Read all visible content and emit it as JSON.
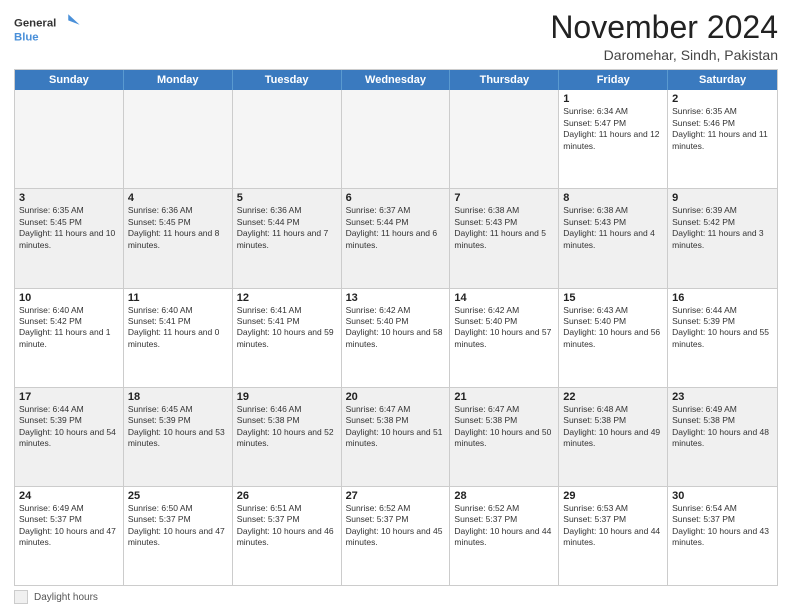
{
  "logo": {
    "line1": "General",
    "line2": "Blue"
  },
  "title": "November 2024",
  "location": "Daromehar, Sindh, Pakistan",
  "weekdays": [
    "Sunday",
    "Monday",
    "Tuesday",
    "Wednesday",
    "Thursday",
    "Friday",
    "Saturday"
  ],
  "legend": {
    "box_label": "Daylight hours"
  },
  "weeks": [
    [
      {
        "day": "",
        "info": "",
        "empty": true
      },
      {
        "day": "",
        "info": "",
        "empty": true
      },
      {
        "day": "",
        "info": "",
        "empty": true
      },
      {
        "day": "",
        "info": "",
        "empty": true
      },
      {
        "day": "",
        "info": "",
        "empty": true
      },
      {
        "day": "1",
        "info": "Sunrise: 6:34 AM\nSunset: 5:47 PM\nDaylight: 11 hours and 12 minutes.",
        "empty": false
      },
      {
        "day": "2",
        "info": "Sunrise: 6:35 AM\nSunset: 5:46 PM\nDaylight: 11 hours and 11 minutes.",
        "empty": false
      }
    ],
    [
      {
        "day": "3",
        "info": "Sunrise: 6:35 AM\nSunset: 5:45 PM\nDaylight: 11 hours and 10 minutes.",
        "empty": false
      },
      {
        "day": "4",
        "info": "Sunrise: 6:36 AM\nSunset: 5:45 PM\nDaylight: 11 hours and 8 minutes.",
        "empty": false
      },
      {
        "day": "5",
        "info": "Sunrise: 6:36 AM\nSunset: 5:44 PM\nDaylight: 11 hours and 7 minutes.",
        "empty": false
      },
      {
        "day": "6",
        "info": "Sunrise: 6:37 AM\nSunset: 5:44 PM\nDaylight: 11 hours and 6 minutes.",
        "empty": false
      },
      {
        "day": "7",
        "info": "Sunrise: 6:38 AM\nSunset: 5:43 PM\nDaylight: 11 hours and 5 minutes.",
        "empty": false
      },
      {
        "day": "8",
        "info": "Sunrise: 6:38 AM\nSunset: 5:43 PM\nDaylight: 11 hours and 4 minutes.",
        "empty": false
      },
      {
        "day": "9",
        "info": "Sunrise: 6:39 AM\nSunset: 5:42 PM\nDaylight: 11 hours and 3 minutes.",
        "empty": false
      }
    ],
    [
      {
        "day": "10",
        "info": "Sunrise: 6:40 AM\nSunset: 5:42 PM\nDaylight: 11 hours and 1 minute.",
        "empty": false
      },
      {
        "day": "11",
        "info": "Sunrise: 6:40 AM\nSunset: 5:41 PM\nDaylight: 11 hours and 0 minutes.",
        "empty": false
      },
      {
        "day": "12",
        "info": "Sunrise: 6:41 AM\nSunset: 5:41 PM\nDaylight: 10 hours and 59 minutes.",
        "empty": false
      },
      {
        "day": "13",
        "info": "Sunrise: 6:42 AM\nSunset: 5:40 PM\nDaylight: 10 hours and 58 minutes.",
        "empty": false
      },
      {
        "day": "14",
        "info": "Sunrise: 6:42 AM\nSunset: 5:40 PM\nDaylight: 10 hours and 57 minutes.",
        "empty": false
      },
      {
        "day": "15",
        "info": "Sunrise: 6:43 AM\nSunset: 5:40 PM\nDaylight: 10 hours and 56 minutes.",
        "empty": false
      },
      {
        "day": "16",
        "info": "Sunrise: 6:44 AM\nSunset: 5:39 PM\nDaylight: 10 hours and 55 minutes.",
        "empty": false
      }
    ],
    [
      {
        "day": "17",
        "info": "Sunrise: 6:44 AM\nSunset: 5:39 PM\nDaylight: 10 hours and 54 minutes.",
        "empty": false
      },
      {
        "day": "18",
        "info": "Sunrise: 6:45 AM\nSunset: 5:39 PM\nDaylight: 10 hours and 53 minutes.",
        "empty": false
      },
      {
        "day": "19",
        "info": "Sunrise: 6:46 AM\nSunset: 5:38 PM\nDaylight: 10 hours and 52 minutes.",
        "empty": false
      },
      {
        "day": "20",
        "info": "Sunrise: 6:47 AM\nSunset: 5:38 PM\nDaylight: 10 hours and 51 minutes.",
        "empty": false
      },
      {
        "day": "21",
        "info": "Sunrise: 6:47 AM\nSunset: 5:38 PM\nDaylight: 10 hours and 50 minutes.",
        "empty": false
      },
      {
        "day": "22",
        "info": "Sunrise: 6:48 AM\nSunset: 5:38 PM\nDaylight: 10 hours and 49 minutes.",
        "empty": false
      },
      {
        "day": "23",
        "info": "Sunrise: 6:49 AM\nSunset: 5:38 PM\nDaylight: 10 hours and 48 minutes.",
        "empty": false
      }
    ],
    [
      {
        "day": "24",
        "info": "Sunrise: 6:49 AM\nSunset: 5:37 PM\nDaylight: 10 hours and 47 minutes.",
        "empty": false
      },
      {
        "day": "25",
        "info": "Sunrise: 6:50 AM\nSunset: 5:37 PM\nDaylight: 10 hours and 47 minutes.",
        "empty": false
      },
      {
        "day": "26",
        "info": "Sunrise: 6:51 AM\nSunset: 5:37 PM\nDaylight: 10 hours and 46 minutes.",
        "empty": false
      },
      {
        "day": "27",
        "info": "Sunrise: 6:52 AM\nSunset: 5:37 PM\nDaylight: 10 hours and 45 minutes.",
        "empty": false
      },
      {
        "day": "28",
        "info": "Sunrise: 6:52 AM\nSunset: 5:37 PM\nDaylight: 10 hours and 44 minutes.",
        "empty": false
      },
      {
        "day": "29",
        "info": "Sunrise: 6:53 AM\nSunset: 5:37 PM\nDaylight: 10 hours and 44 minutes.",
        "empty": false
      },
      {
        "day": "30",
        "info": "Sunrise: 6:54 AM\nSunset: 5:37 PM\nDaylight: 10 hours and 43 minutes.",
        "empty": false
      }
    ]
  ]
}
